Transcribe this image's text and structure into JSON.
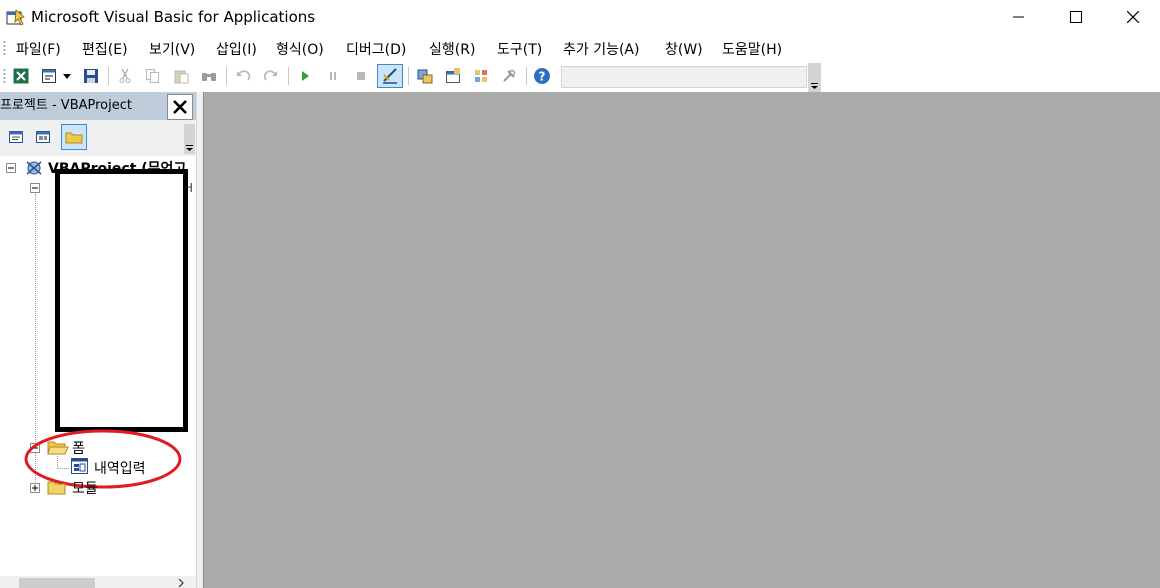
{
  "window": {
    "title": "Microsoft Visual Basic for Applications",
    "controls": [
      "minimize",
      "maximize",
      "close"
    ]
  },
  "menu": {
    "items": [
      "파일(F)",
      "편집(E)",
      "보기(V)",
      "삽입(I)",
      "형식(O)",
      "디버그(D)",
      "실행(R)",
      "도구(T)",
      "추가 기능(A)",
      "창(W)",
      "도움말(H)"
    ]
  },
  "toolbar": {
    "icons": [
      "excel-icon",
      "insert-userform-icon",
      "dropdown-arrow-icon",
      "save-icon",
      "cut-icon",
      "copy-icon",
      "paste-icon",
      "find-icon",
      "undo-icon",
      "redo-icon",
      "run-icon",
      "break-icon",
      "reset-icon",
      "design-mode-icon",
      "project-explorer-icon",
      "properties-icon",
      "object-browser-icon",
      "toolbox-icon",
      "help-icon"
    ],
    "position_text": ""
  },
  "project_explorer": {
    "title": "프로젝트 - VBAProject",
    "close_label": "✕",
    "root_label": "VBAProject (무언고",
    "forms_folder_label": "폼",
    "form_item_label": "내역입력",
    "modules_folder_label": "모듈",
    "redacted": true
  },
  "annotation": {
    "shape": "ellipse",
    "color": "#e01b24"
  },
  "colors": {
    "workspace": "#ababab",
    "explorer_header": "#bfcddb",
    "annotation": "#e01b24"
  }
}
